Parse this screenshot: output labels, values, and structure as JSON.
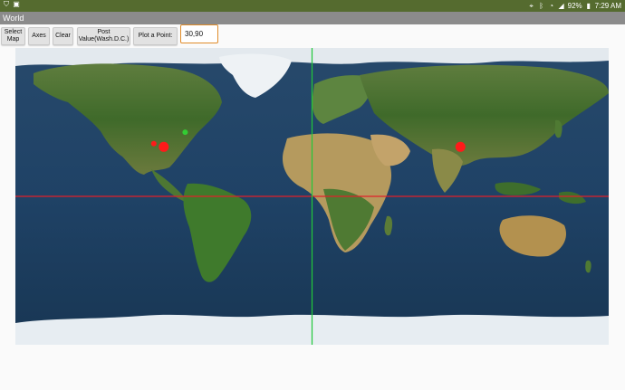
{
  "status_bar": {
    "battery": "92%",
    "time": "7:29 AM"
  },
  "window": {
    "title": "World"
  },
  "toolbar": {
    "select_map": "Select\nMap",
    "axes": "Axes",
    "clear": "Clear",
    "post_value": "Post\nValue(Wash.D.C.)",
    "plot_point_label": "Plot a Point:",
    "plot_point_value": "30,90"
  },
  "map": {
    "type": "world-satellite",
    "axes": {
      "equator_color": "#e0202a",
      "prime_meridian_color": "#22c83a"
    },
    "points": [
      {
        "lat": 30,
        "lon": 90,
        "color": "#ff1a1a",
        "size": "large"
      },
      {
        "lat": 30,
        "lon": -90,
        "color": "#ff1a1a",
        "size": "large"
      },
      {
        "lat": 32,
        "lon": -96,
        "color": "#ff1a1a",
        "size": "small"
      },
      {
        "lat": 38.9,
        "lon": -77,
        "color": "#33cc33",
        "size": "small"
      }
    ]
  }
}
